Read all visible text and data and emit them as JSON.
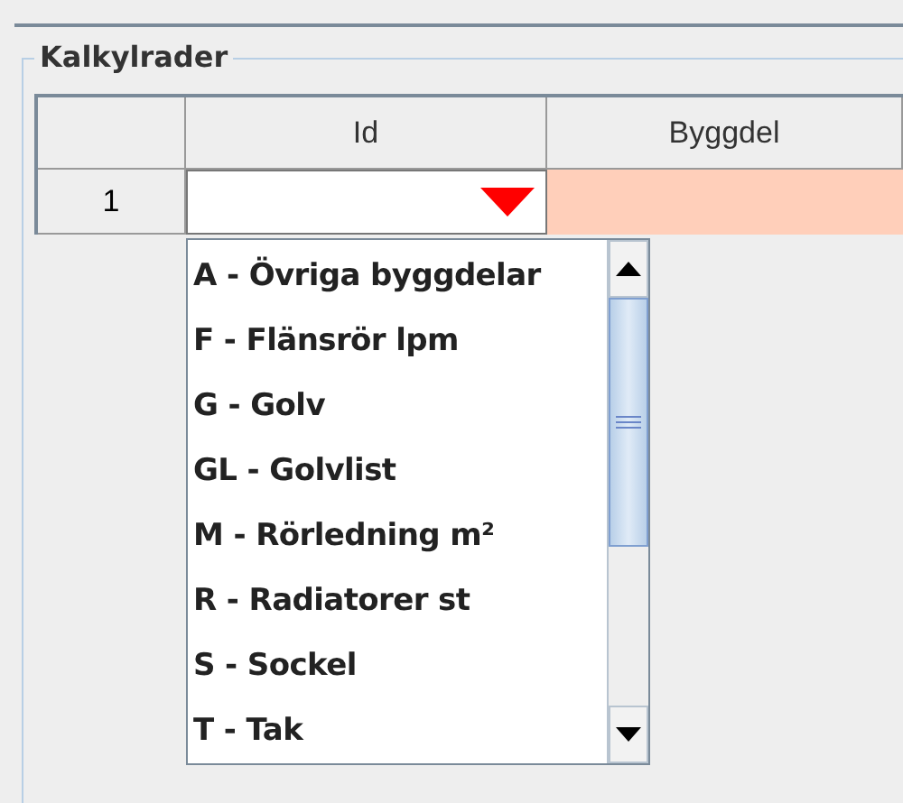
{
  "panel": {
    "title": "Kalkylrader"
  },
  "table": {
    "columns": [
      "Id",
      "Byggdel"
    ],
    "rows": [
      {
        "row_header": "1",
        "id": "",
        "byggdel": ""
      }
    ]
  },
  "dropdown": {
    "items": [
      {
        "label": "A - Övriga byggdelar",
        "selected": false
      },
      {
        "label": "F - Flänsrör lpm",
        "selected": false
      },
      {
        "label": "G - Golv",
        "selected": false
      },
      {
        "label": "GL - Golvlist",
        "selected": false
      },
      {
        "label": "M - Rörledning m²",
        "selected": false
      },
      {
        "label": "R - Radiatorer st",
        "selected": false
      },
      {
        "label": "S - Sockel",
        "selected": false
      },
      {
        "label": "T - Tak",
        "selected": false
      }
    ]
  }
}
